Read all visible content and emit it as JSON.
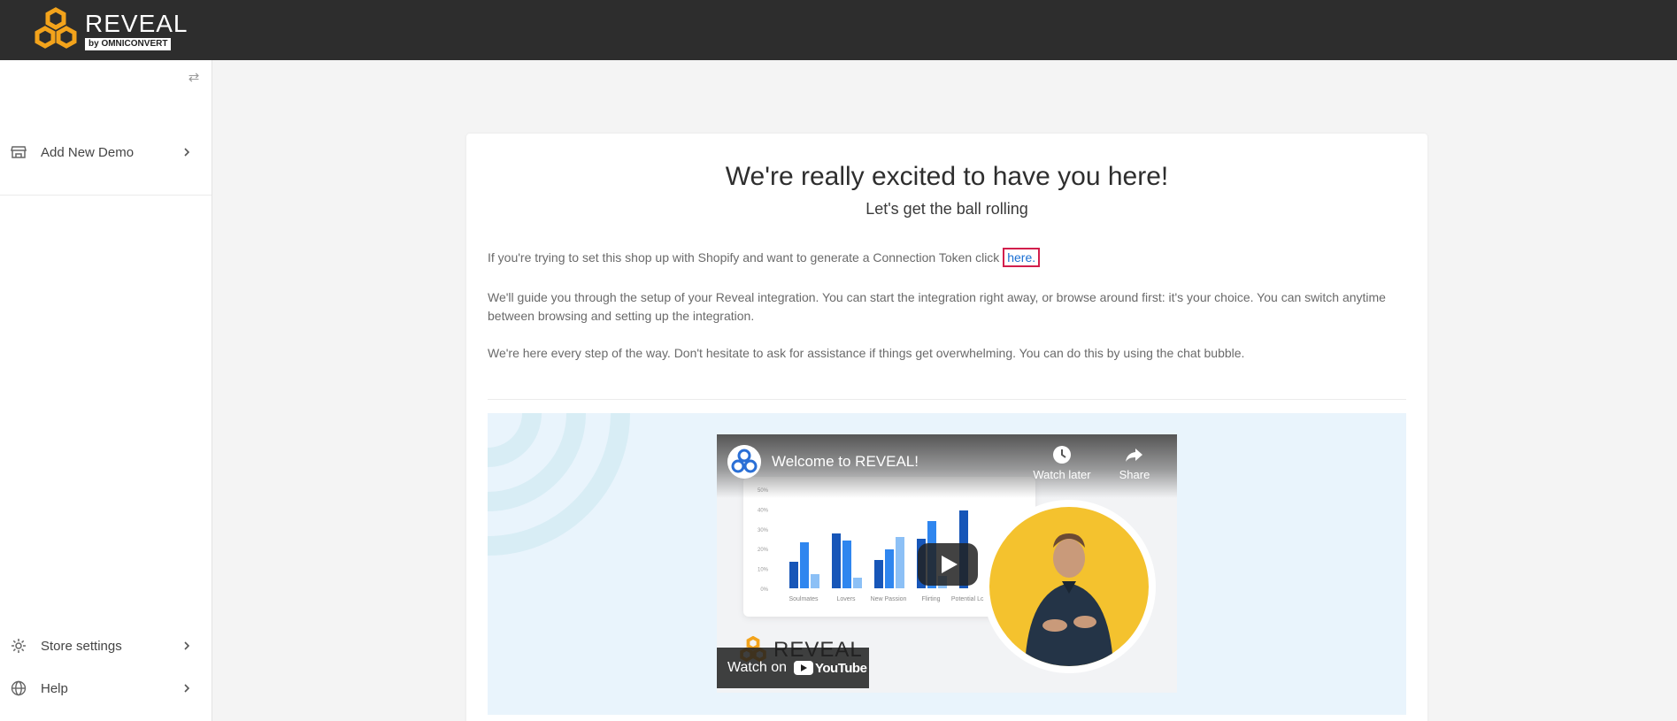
{
  "brand": {
    "name": "REVEAL",
    "subtitle": "by OMNICONVERT",
    "accent": "#f3a31b"
  },
  "sidebar": {
    "toggle_icon": "swap-arrows-icon",
    "items": [
      {
        "label": "Add New Demo",
        "icon": "store-icon"
      },
      {
        "label": "Store settings",
        "icon": "gear-icon"
      },
      {
        "label": "Help",
        "icon": "globe-icon"
      }
    ]
  },
  "welcome": {
    "title": "We're really excited to have you here!",
    "subtitle": "Let's get the ball rolling",
    "p1_text": "If you're trying to set this shop up with Shopify and want to generate a Connection Token click ",
    "p1_link": "here.",
    "p2": "We'll guide you through the setup of your Reveal integration. You can start the integration right away, or browse around first: it's your choice. You can switch anytime between browsing and setting up the integration.",
    "p3": "We're here every step of the way. Don't hesitate to ask for assistance if things get overwhelming. You can do this by using the chat bubble."
  },
  "video": {
    "title": "Welcome to REVEAL!",
    "watch_later": "Watch later",
    "share": "Share",
    "watch_on": "Watch on",
    "youtube": "YouTube",
    "brand_word": "REVEAL",
    "chart": {
      "categories": [
        "Soulmates",
        "Lovers",
        "New Passion",
        "Flirting",
        "Potential Lovers"
      ],
      "yticks": [
        "50%",
        "40%",
        "30%",
        "20%",
        "10%",
        "0%"
      ]
    }
  }
}
